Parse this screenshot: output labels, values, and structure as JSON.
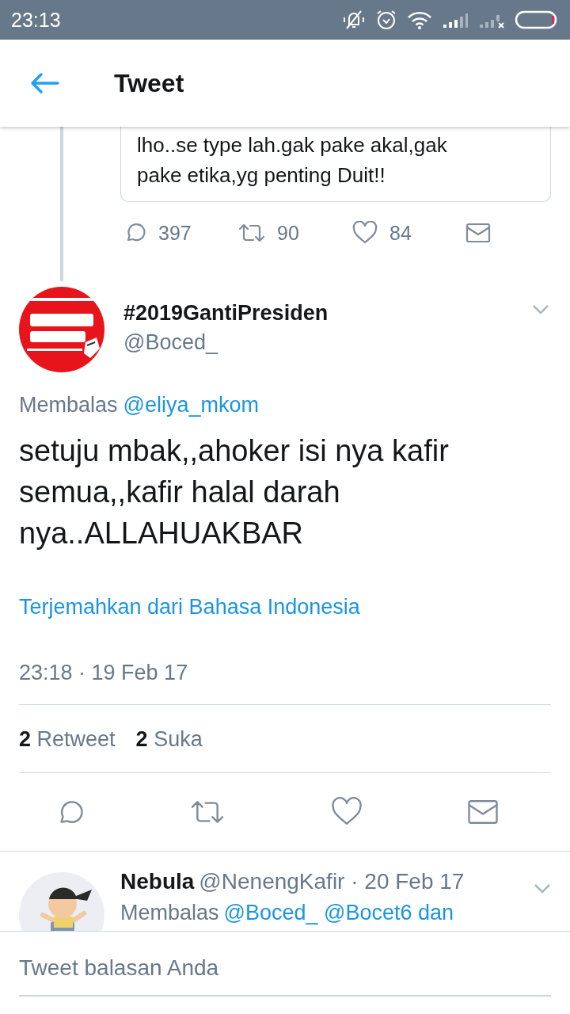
{
  "status_bar": {
    "time": "23:13"
  },
  "header": {
    "title": "Tweet"
  },
  "quoted_tweet": {
    "text": "lho..se type lah.gak pake akal,gak pake etika,yg penting Duit!!"
  },
  "parent_actions": {
    "replies": "397",
    "retweets": "90",
    "likes": "84"
  },
  "tweet": {
    "name": "#2019GantiPresiden",
    "handle": "@Boced_",
    "reply_prefix": "Membalas",
    "reply_to": "@eliya_mkom",
    "text": "setuju mbak,,ahoker isi nya kafir semua,,kafir halal darah nya..ALLAHUAKBAR",
    "translate": "Terjemahkan dari Bahasa Indonesia",
    "timestamp": "23:18 · 19 Feb 17",
    "stats": [
      {
        "count": "2",
        "label": "Retweet"
      },
      {
        "count": "2",
        "label": "Suka"
      }
    ]
  },
  "reply": {
    "name": "Nebula",
    "meta": "@NenengKafir · 20 Feb 17",
    "reply_prefix": "Membalas",
    "reply_to": "@Boced_ @Bocet6 dan"
  },
  "composer": {
    "placeholder": "Tweet balasan Anda"
  }
}
